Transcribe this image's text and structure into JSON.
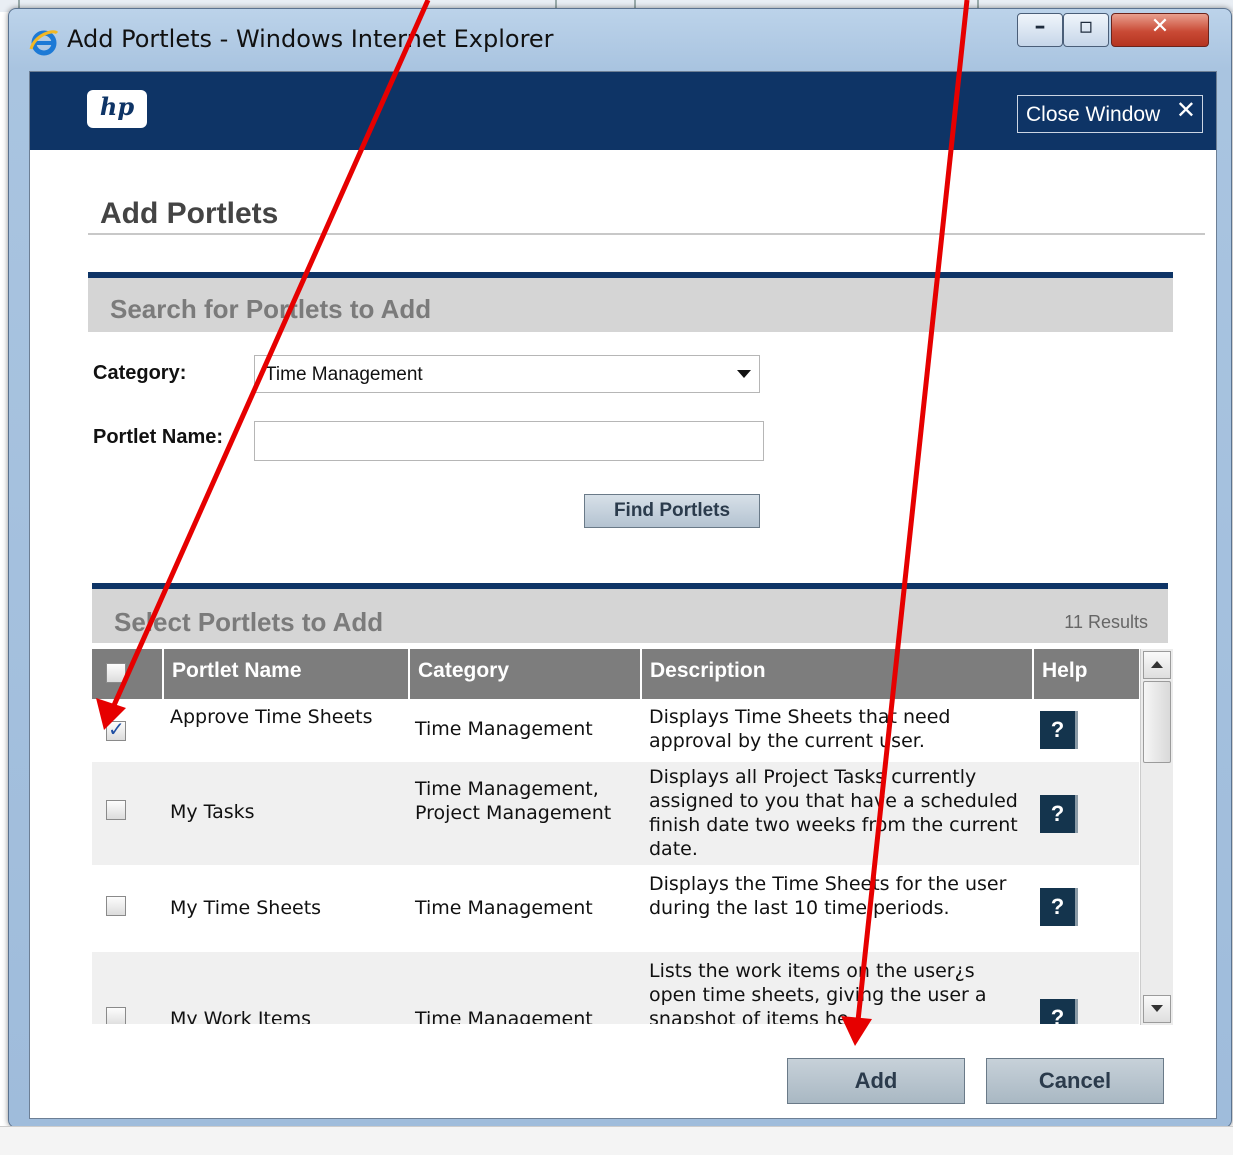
{
  "window": {
    "title": "Add Portlets - Windows Internet Explorer",
    "buttons": [
      "minimize",
      "maximize",
      "close"
    ]
  },
  "colors": {
    "brand_bar": "#0e3466",
    "section_header_bg": "#d5d5d5",
    "grid_header_bg": "#7d7d7d",
    "help_button": "#14344d",
    "annotation_arrow": "#e60000"
  },
  "header": {
    "logo_text": "hp",
    "close_window_label": "Close Window"
  },
  "page": {
    "title": "Add Portlets"
  },
  "search": {
    "section_title": "Search for Portlets to Add",
    "category_label": "Category:",
    "category_value": "Time Management",
    "portlet_name_label": "Portlet Name:",
    "portlet_name_value": "",
    "find_button": "Find Portlets"
  },
  "results": {
    "section_title": "Select Portlets to Add",
    "count": "11 Results",
    "columns": [
      "Portlet Name",
      "Category",
      "Description",
      "Help"
    ],
    "help_label": "?",
    "rows": [
      {
        "checked": true,
        "name": "Approve Time Sheets",
        "category": "Time Management",
        "description": "Displays Time Sheets that need approval by the current user."
      },
      {
        "checked": false,
        "name": "My Tasks",
        "category": "Time Management, Project Management",
        "description": "Displays all Project Tasks currently assigned to you that have a scheduled finish date two weeks from the current date."
      },
      {
        "checked": false,
        "name": "My Time Sheets",
        "category": "Time Management",
        "description": "Displays the Time Sheets for the user during the last 10 time periods."
      },
      {
        "checked": false,
        "name": "My Work Items",
        "category": "Time Management",
        "description": "Lists the work items on the user¿s open time sheets, giving the user a snapshot of items he"
      }
    ]
  },
  "actions": {
    "add": "Add",
    "cancel": "Cancel"
  }
}
